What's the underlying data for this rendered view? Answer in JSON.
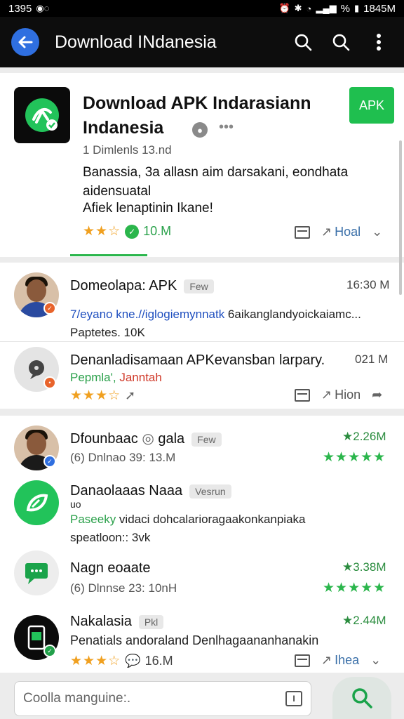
{
  "status_bar": {
    "time": "1395",
    "right_time": "1845M",
    "signal_percent": "%"
  },
  "appbar": {
    "title": "Download INdanesia"
  },
  "hero": {
    "title": "Download APK Indarasiann Indanesia",
    "apk_label": "APK",
    "meta": "1 Dimlenls 13.nd",
    "description": "Banassia, 3a allasn aim darsakani, eondhata aidensuatal",
    "description2": "Afiek lenaptinin Ikane!",
    "rating_stars": "★★☆",
    "rating_value": 2.5,
    "downloads": "10.M",
    "action_label": "Hoal"
  },
  "list_mid": [
    {
      "title": "Domeolapa: APK",
      "tag": "Few",
      "right": "16:30 M",
      "link_text": "7/eyano kne.//iglogiemynnatk",
      "link_rest": " 6aikanglandyoickaiamc...",
      "sub": "Paptetes. 10K"
    },
    {
      "title": "Denanladisamaan APKevansban larpary.",
      "right": "021 M",
      "green_text": "Pepmla',",
      "red_text": " Janntah",
      "stars": "★★★☆",
      "rating_value": 3.5,
      "action_label": "Hion"
    }
  ],
  "list_bot": [
    {
      "title": "Dfounbaac",
      "title_extra": "gala",
      "tag": "Few",
      "right": "★2.26M",
      "meta": "(6) Dnlnao 39: 13.M",
      "stars": "★★★★★",
      "rating_value": 5
    },
    {
      "title": "Danaolaaas Naaa",
      "tag": "Vesrun",
      "u_text": "uo",
      "green_text": "Paseeky",
      "desc_rest": " vidaci dohcalarioragaakonkanpiaka",
      "sub": "speatloon:: 3vk"
    },
    {
      "title": "Nagn eoaate",
      "right": "★3.38M",
      "meta": "(6) Dlnnse 23: 10nH",
      "stars": "★★★★★",
      "rating_value": 5
    },
    {
      "title": "Nakalasia",
      "tag": "Pkl",
      "right": "★2.44M",
      "desc": "Penatials andoraland Denlhagaananhanakin",
      "stars": "★★★☆",
      "rating_value": 3.5,
      "downloads": "16.M",
      "action_label": "Ihea"
    }
  ],
  "search": {
    "placeholder": "Coolla manguine:.",
    "kbd_label": "I"
  },
  "colors": {
    "accent_green": "#22c35a",
    "back_blue": "#2f6fe0",
    "star_orange": "#f0a020",
    "link_blue": "#1f4fbf"
  },
  "icons": [
    "back-arrow-icon",
    "search-icon",
    "more-vert-icon",
    "download-icon",
    "save-icon",
    "share-icon",
    "chevron-down-icon",
    "pin-icon",
    "forward-icon",
    "keyboard-icon"
  ]
}
